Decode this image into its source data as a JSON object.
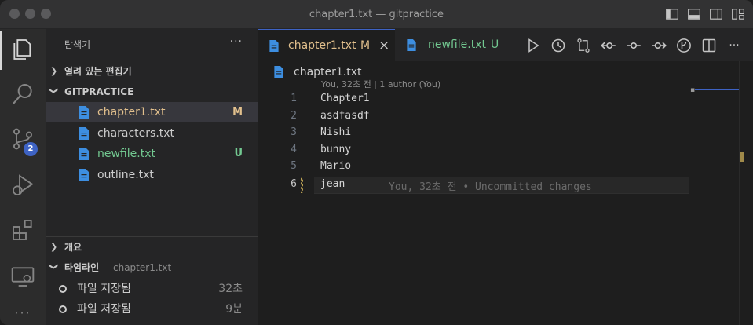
{
  "window": {
    "title": "chapter1.txt — gitpractice"
  },
  "sidebar": {
    "title": "탐색기",
    "more_label": "···",
    "open_editors_label": "열려 있는 편집기",
    "folder_label": "GITPRACTICE",
    "files": [
      {
        "name": "chapter1.txt",
        "status": "M",
        "state": "modified",
        "selected": true
      },
      {
        "name": "characters.txt",
        "status": "",
        "state": "normal",
        "selected": false
      },
      {
        "name": "newfile.txt",
        "status": "U",
        "state": "untracked",
        "selected": false
      },
      {
        "name": "outline.txt",
        "status": "",
        "state": "normal",
        "selected": false
      }
    ],
    "outline_label": "개요",
    "timeline_label": "타임라인",
    "timeline_file": "chapter1.txt",
    "timeline": [
      {
        "label": "파일 저장됨",
        "time": "32초"
      },
      {
        "label": "파일 저장됨",
        "time": "9분"
      }
    ]
  },
  "activity_bar": {
    "source_control_badge": "2",
    "icons": [
      "files-icon",
      "search-icon",
      "source-control-icon",
      "run-debug-icon",
      "extensions-icon",
      "remote-explorer-icon"
    ]
  },
  "tabs": [
    {
      "label": "chapter1.txt",
      "status": "M",
      "active": true,
      "close": "×"
    },
    {
      "label": "newfile.txt",
      "status": "U",
      "active": false
    }
  ],
  "editor": {
    "breadcrumb": "chapter1.txt",
    "codelens": "You, 32초 전 | 1 author (You)",
    "lines": [
      {
        "n": "1",
        "text": "Chapter1"
      },
      {
        "n": "2",
        "text": "asdfasdf"
      },
      {
        "n": "3",
        "text": "Nishi"
      },
      {
        "n": "4",
        "text": "bunny"
      },
      {
        "n": "5",
        "text": "Mario"
      },
      {
        "n": "6",
        "text": "jean"
      }
    ],
    "blame": "You, 32초 전 • Uncommitted changes"
  },
  "colors": {
    "modified": "#e2c08d",
    "untracked": "#73c991",
    "accent": "#3e63c4",
    "file_icon": "#3d8ee0"
  }
}
